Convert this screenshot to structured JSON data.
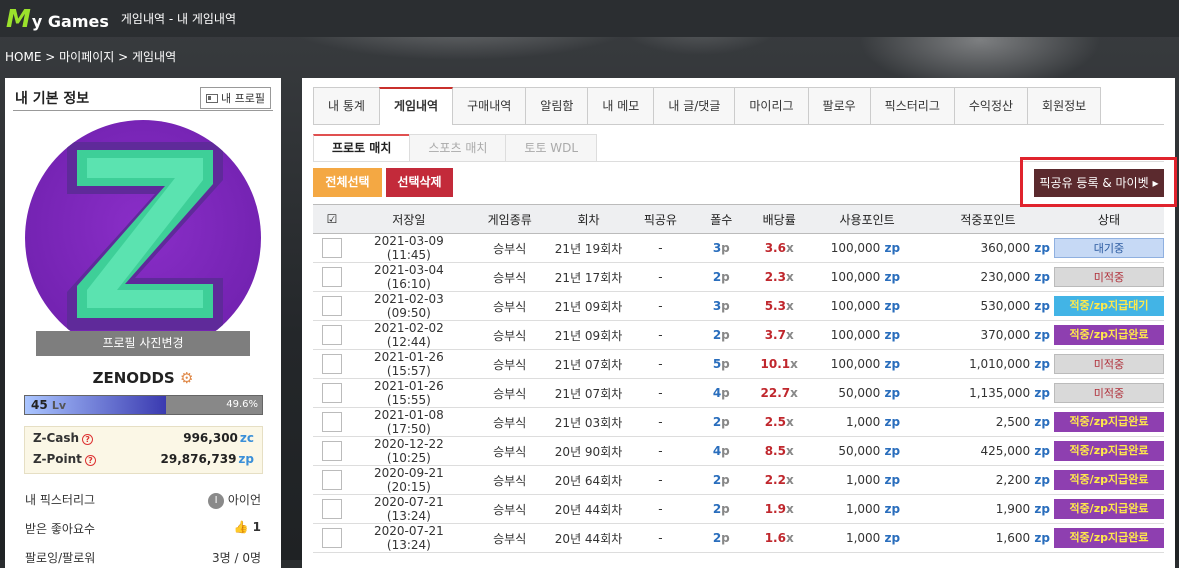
{
  "header": {
    "logo_m": "M",
    "logo_rest": "y Games",
    "subtitle": "게임내역 - 내 게임내역"
  },
  "breadcrumb": "HOME > 마이페이지 > 게임내역",
  "left": {
    "title": "내 기본 정보",
    "profile_btn": "내 프로필",
    "photo_change": "프로필 사진변경",
    "username": "ZENODDS",
    "level": "45",
    "level_unit": "Lv",
    "level_pct": "49.6%",
    "level_fill": 0.496,
    "zcash_label": "Z-Cash",
    "zcash": "996,300",
    "zcash_unit": "zc",
    "zpoint_label": "Z-Point",
    "zpoint": "29,876,739",
    "zpoint_unit": "zp",
    "pickstory_label": "내 픽스터리그",
    "pickstory_val": "아이언",
    "likes_label": "받은 좋아요수",
    "likes_val": "1",
    "follow_label": "팔로잉/팔로워",
    "follow_val": "3명 / 0명"
  },
  "tabs": [
    "내 통계",
    "게임내역",
    "구매내역",
    "알림함",
    "내 메모",
    "내 글/댓글",
    "마이리그",
    "팔로우",
    "픽스터리그",
    "수익정산",
    "회원정보"
  ],
  "subtabs": [
    "프로토 매치",
    "스포츠 매치",
    "토토 WDL"
  ],
  "buttons": {
    "select_all": "전체선택",
    "delete_selected": "선택삭제",
    "pick_share": "픽공유 등록 & 마이벳"
  },
  "columns": [
    "저장일",
    "게임종류",
    "회차",
    "픽공유",
    "폴수",
    "배당률",
    "사용포인트",
    "적중포인트",
    "상태"
  ],
  "colors": {
    "waiting": "#c6d9f5",
    "miss": "#d9d9d9",
    "pending": "#42b4e6",
    "done": "#8e3fb0"
  },
  "rows": [
    {
      "date": "2021-03-09 (11:45)",
      "type": "승부식",
      "round": "21년 19회차",
      "share": "-",
      "folds": "3",
      "odds": "3.6",
      "use": "100,000",
      "hit": "360,000",
      "status": "대기중",
      "st": "waiting"
    },
    {
      "date": "2021-03-04 (16:10)",
      "type": "승부식",
      "round": "21년 17회차",
      "share": "-",
      "folds": "2",
      "odds": "2.3",
      "use": "100,000",
      "hit": "230,000",
      "status": "미적중",
      "st": "miss"
    },
    {
      "date": "2021-02-03 (09:50)",
      "type": "승부식",
      "round": "21년 09회차",
      "share": "-",
      "folds": "3",
      "odds": "5.3",
      "use": "100,000",
      "hit": "530,000",
      "status": "적중/zp지급대기",
      "st": "pending"
    },
    {
      "date": "2021-02-02 (12:44)",
      "type": "승부식",
      "round": "21년 09회차",
      "share": "-",
      "folds": "2",
      "odds": "3.7",
      "use": "100,000",
      "hit": "370,000",
      "status": "적중/zp지급완료",
      "st": "done"
    },
    {
      "date": "2021-01-26 (15:57)",
      "type": "승부식",
      "round": "21년 07회차",
      "share": "-",
      "folds": "5",
      "odds": "10.1",
      "use": "100,000",
      "hit": "1,010,000",
      "status": "미적중",
      "st": "miss"
    },
    {
      "date": "2021-01-26 (15:55)",
      "type": "승부식",
      "round": "21년 07회차",
      "share": "-",
      "folds": "4",
      "odds": "22.7",
      "use": "50,000",
      "hit": "1,135,000",
      "status": "미적중",
      "st": "miss"
    },
    {
      "date": "2021-01-08 (17:50)",
      "type": "승부식",
      "round": "21년 03회차",
      "share": "-",
      "folds": "2",
      "odds": "2.5",
      "use": "1,000",
      "hit": "2,500",
      "status": "적중/zp지급완료",
      "st": "done"
    },
    {
      "date": "2020-12-22 (10:25)",
      "type": "승부식",
      "round": "20년 90회차",
      "share": "-",
      "folds": "4",
      "odds": "8.5",
      "use": "50,000",
      "hit": "425,000",
      "status": "적중/zp지급완료",
      "st": "done"
    },
    {
      "date": "2020-09-21 (20:15)",
      "type": "승부식",
      "round": "20년 64회차",
      "share": "-",
      "folds": "2",
      "odds": "2.2",
      "use": "1,000",
      "hit": "2,200",
      "status": "적중/zp지급완료",
      "st": "done"
    },
    {
      "date": "2020-07-21 (13:24)",
      "type": "승부식",
      "round": "20년 44회차",
      "share": "-",
      "folds": "2",
      "odds": "1.9",
      "use": "1,000",
      "hit": "1,900",
      "status": "적중/zp지급완료",
      "st": "done"
    },
    {
      "date": "2020-07-21 (13:24)",
      "type": "승부식",
      "round": "20년 44회차",
      "share": "-",
      "folds": "2",
      "odds": "1.6",
      "use": "1,000",
      "hit": "1,600",
      "status": "적중/zp지급완료",
      "st": "done"
    }
  ]
}
